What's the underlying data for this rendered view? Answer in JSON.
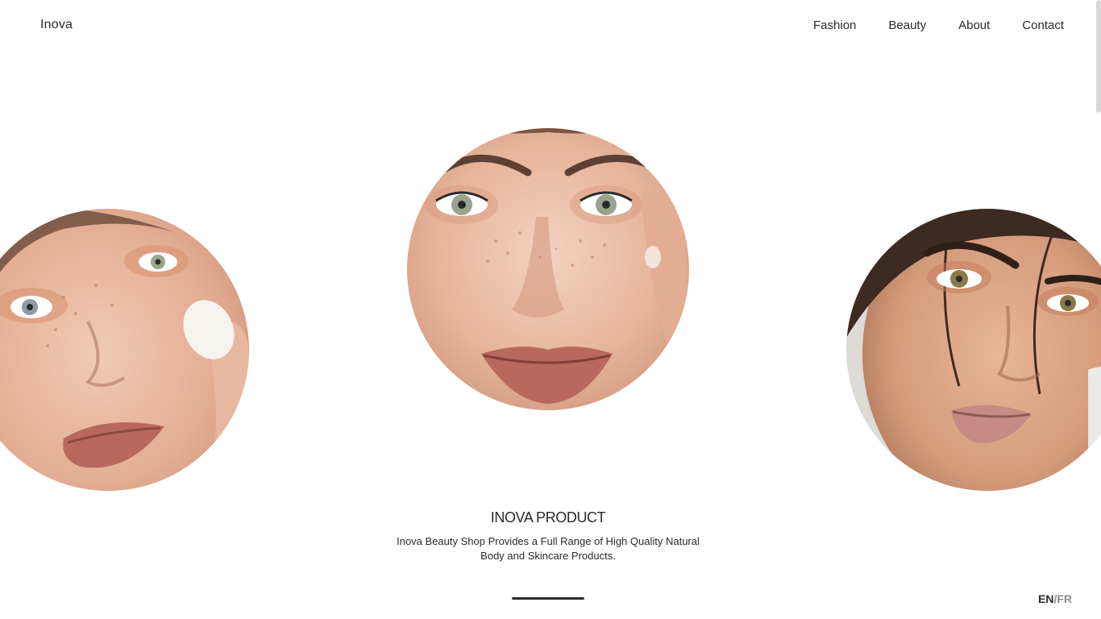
{
  "brand": {
    "logo": "Inova"
  },
  "nav": {
    "items": [
      {
        "label": "Fashion"
      },
      {
        "label": "Beauty"
      },
      {
        "label": "About"
      },
      {
        "label": "Contact"
      }
    ]
  },
  "slider": {
    "slides": [
      {
        "image": "face-portrait-applying-cream"
      },
      {
        "image": "face-portrait-freckles-closeup"
      },
      {
        "image": "face-portrait-dark-hair"
      }
    ],
    "active_index": 1
  },
  "caption": {
    "title": "INOVA PRODUCT",
    "description": "Inova Beauty Shop Provides a Full Range of High Quality Natural Body and Skincare Products."
  },
  "language": {
    "current": "EN",
    "separator": "/",
    "alternate": "FR"
  },
  "colors": {
    "text": "#2a2a2a",
    "skin": "#e6b59a",
    "lips": "#b8685c"
  }
}
